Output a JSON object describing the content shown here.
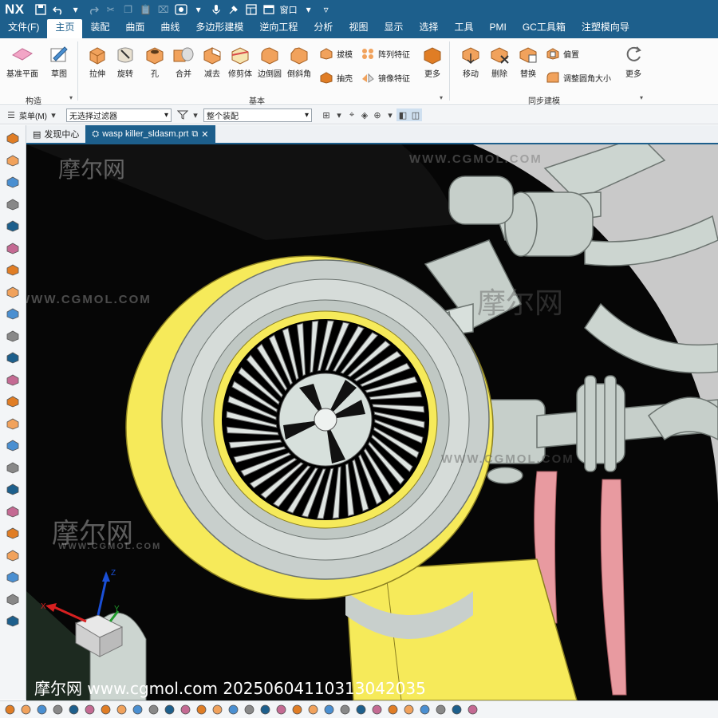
{
  "app": {
    "logo": "NX",
    "window_menu": "窗口"
  },
  "menu_tabs": [
    "文件(F)",
    "主页",
    "装配",
    "曲面",
    "曲线",
    "多边形建模",
    "逆向工程",
    "分析",
    "视图",
    "显示",
    "选择",
    "工具",
    "PMI",
    "GC工具箱",
    "注塑模向导"
  ],
  "active_tab": "主页",
  "ribbon": {
    "groups": [
      {
        "label": "构造",
        "buttons": [
          "基准平面",
          "草图"
        ]
      },
      {
        "label": "基本",
        "buttons": [
          "拉伸",
          "旋转",
          "孔",
          "合并",
          "减去",
          "修剪体",
          "边倒圆",
          "倒斜角"
        ],
        "small_buttons": [
          "拔模",
          "阵列特征",
          "抽壳",
          "镜像特征"
        ],
        "more": "更多"
      },
      {
        "label": "同步建模",
        "buttons": [
          "移动",
          "删除",
          "替换"
        ],
        "small_buttons": [
          "偏置",
          "调整圆角大小"
        ],
        "more": "更多"
      }
    ]
  },
  "filterbar": {
    "menu_label": "菜单(M)",
    "type_filter": "无选择过滤器",
    "scope_filter": "整个装配"
  },
  "doc_tabs": [
    {
      "label": "发现中心",
      "active": false
    },
    {
      "label": "wasp killer_sldasm.prt",
      "active": true
    }
  ],
  "viewport": {
    "watermarks": {
      "brand": "摩尔网",
      "site": "WWW.CGMOL.COM"
    },
    "footer_text": "摩尔网 www.cgmol.com 20250604110313042035",
    "triad_labels": {
      "x": "X",
      "z": "Z",
      "y": "Y"
    },
    "colors": {
      "bg_dark": "#050505",
      "bg_light": "#c9c9c9",
      "yellow": "#f6ea5a",
      "gray_metal": "#c8cfcc",
      "pink": "#e89aa0"
    }
  },
  "left_icons": [
    "view-orient-icon",
    "extrude-icon",
    "block-icon",
    "feature-icon",
    "box-icon",
    "hole-icon",
    "curve-icon",
    "spline-icon",
    "datum-icon",
    "line-icon",
    "surface-icon",
    "arc-icon",
    "wave-icon",
    "offset-icon",
    "measure-icon",
    "point-icon",
    "cube-icon",
    "fillet-icon",
    "pipe-icon",
    "sweep-icon",
    "assembly-icon",
    "pattern-icon",
    "section-icon"
  ],
  "bottom_icons": 30
}
